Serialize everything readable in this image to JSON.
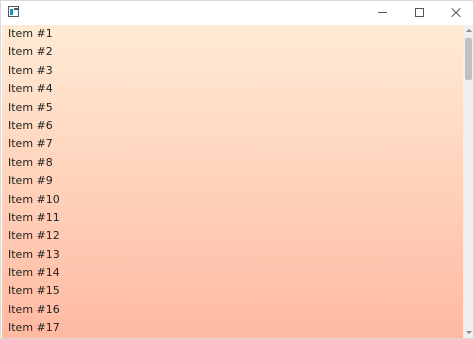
{
  "window": {
    "title": "",
    "icon": "app-window-icon",
    "caption_buttons": [
      "minimize-icon",
      "maximize-icon",
      "close-icon"
    ]
  },
  "list": {
    "items": [
      {
        "label": "Item #1"
      },
      {
        "label": "Item #2"
      },
      {
        "label": "Item #3"
      },
      {
        "label": "Item #4"
      },
      {
        "label": "Item #5"
      },
      {
        "label": "Item #6"
      },
      {
        "label": "Item #7"
      },
      {
        "label": "Item #8"
      },
      {
        "label": "Item #9"
      },
      {
        "label": "Item #10"
      },
      {
        "label": "Item #11"
      },
      {
        "label": "Item #12"
      },
      {
        "label": "Item #13"
      },
      {
        "label": "Item #14"
      },
      {
        "label": "Item #15"
      },
      {
        "label": "Item #16"
      },
      {
        "label": "Item #17"
      }
    ]
  },
  "colors": {
    "gradient_top": "#ffebd5",
    "gradient_bottom": "#ffb9a2",
    "text": "#222222"
  }
}
